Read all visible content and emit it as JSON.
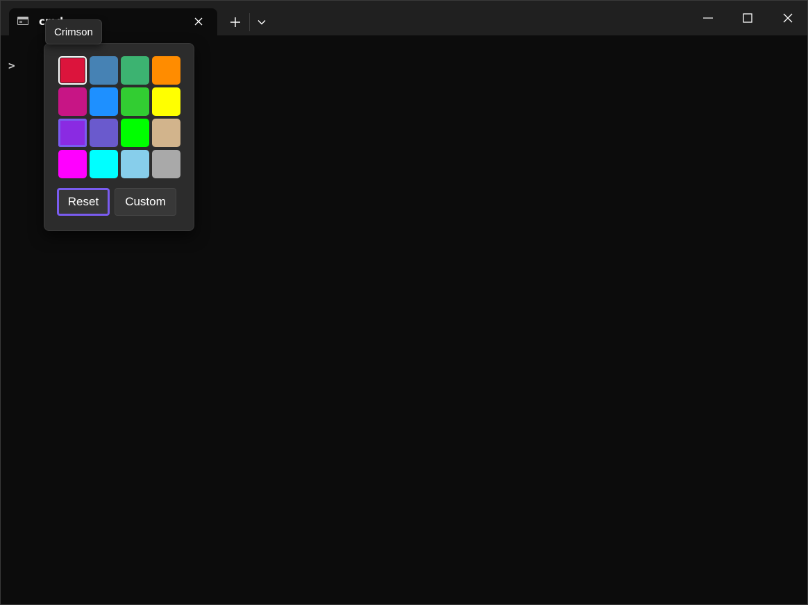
{
  "tab": {
    "title": "cmd",
    "close_icon": "close-icon",
    "icon": "console-icon"
  },
  "toolbar": {
    "new_tab_icon": "plus-icon",
    "dropdown_icon": "chevron-down-icon"
  },
  "window_controls": {
    "minimize_icon": "minimize-icon",
    "maximize_icon": "maximize-icon",
    "close_icon": "close-icon"
  },
  "terminal": {
    "prompt": ">"
  },
  "tooltip": {
    "text": "Crimson"
  },
  "color_picker": {
    "swatches": [
      {
        "color": "#dc143c",
        "selected": true
      },
      {
        "color": "#4682b4"
      },
      {
        "color": "#3cb371"
      },
      {
        "color": "#ff8c00"
      },
      {
        "color": "#c71585"
      },
      {
        "color": "#1e90ff"
      },
      {
        "color": "#32cd32"
      },
      {
        "color": "#ffff00"
      },
      {
        "color": "#8a2be2",
        "focused": true
      },
      {
        "color": "#6a5acd"
      },
      {
        "color": "#00ff00"
      },
      {
        "color": "#d2b48c"
      },
      {
        "color": "#ff00ff"
      },
      {
        "color": "#00ffff"
      },
      {
        "color": "#87ceeb"
      },
      {
        "color": "#a9a9a9"
      }
    ],
    "reset_label": "Reset",
    "custom_label": "Custom"
  },
  "colors": {
    "focus_ring": "#7a5cf0",
    "titlebar": "#202020",
    "terminal_bg": "#0c0c0c"
  }
}
